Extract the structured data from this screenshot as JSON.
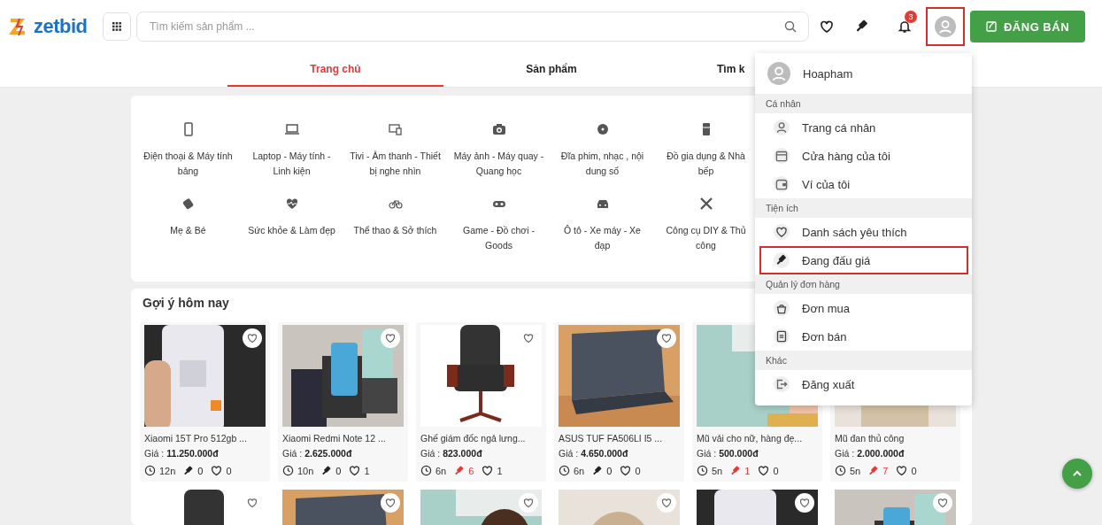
{
  "header": {
    "logo": "zetbid",
    "search": {
      "placeholder": "Tìm kiếm sản phẩm ..."
    },
    "notifications": {
      "count": "3"
    },
    "account": {
      "highlighted": true
    },
    "sell_button": "ĐĂNG BÁN"
  },
  "tabs": [
    {
      "label": "Trang chủ",
      "selected": true
    },
    {
      "label": "Sản phẩm",
      "selected": false
    },
    {
      "label": "Tìm k",
      "selected": false
    }
  ],
  "categories": [
    {
      "label": "Điện thoại & Máy tính bảng"
    },
    {
      "label": "Laptop - Máy tính - Linh kiện"
    },
    {
      "label": "Tivi - Âm thanh - Thiết bị nghe nhìn"
    },
    {
      "label": "Máy ảnh - Máy quay - Quang học"
    },
    {
      "label": "Đĩa phim, nhạc , nội dung số"
    },
    {
      "label": "Đồ gia dụng & Nhà bếp"
    },
    {
      "label": "Mẹ & Bé"
    },
    {
      "label": "Sức khỏe & Làm đẹp"
    },
    {
      "label": "Thể thao & Sở thích"
    },
    {
      "label": "Game - Đồ chơi - Goods"
    },
    {
      "label": "Ô tô - Xe máy - Xe đạp"
    },
    {
      "label": "Công cụ DIY & Thủ công"
    }
  ],
  "suggestions": {
    "title": "Gợi ý hôm nay",
    "products": [
      {
        "name": "Xiaomi 15T Pro 512gb ...",
        "price_label": "Giá :",
        "price": "11.250.000đ",
        "time": "12n",
        "bids": "0",
        "bids_active": false,
        "likes": "0",
        "favorite_button": true
      },
      {
        "name": "Xiaomi Redmi Note 12 ...",
        "price_label": "Giá :",
        "price": "2.625.000đ",
        "time": "10n",
        "bids": "0",
        "bids_active": false,
        "likes": "1",
        "favorite_button": true
      },
      {
        "name": "Ghế giám đốc ngả lưng...",
        "price_label": "Giá :",
        "price": "823.000đ",
        "time": "6n",
        "bids": "6",
        "bids_active": true,
        "likes": "1",
        "favorite_button": true
      },
      {
        "name": "ASUS TUF FA506LI I5 ...",
        "price_label": "Giá :",
        "price": "4.650.000đ",
        "time": "6n",
        "bids": "0",
        "bids_active": false,
        "likes": "0",
        "favorite_button": true
      },
      {
        "name": "Mũ vải cho nữ, hàng đẹ...",
        "price_label": "Giá :",
        "price": "500.000đ",
        "time": "5n",
        "bids": "1",
        "bids_active": true,
        "likes": "0"
      },
      {
        "name": "Mũ đan thủ công",
        "price_label": "Giá :",
        "price": "2.000.000đ",
        "time": "5n",
        "bids": "7",
        "bids_active": true,
        "likes": "0"
      }
    ]
  },
  "user_menu": {
    "user": "Hoapham",
    "sections": [
      {
        "title": "Cá nhân",
        "items": [
          {
            "label": "Trang cá nhân",
            "highlighted": false
          },
          {
            "label": "Cửa hàng của tôi",
            "highlighted": false
          },
          {
            "label": "Ví của tôi",
            "highlighted": false
          }
        ]
      },
      {
        "title": "Tiện ích",
        "items": [
          {
            "label": "Danh sách yêu thích",
            "highlighted": false
          },
          {
            "label": "Đang đấu giá",
            "highlighted": true
          }
        ]
      },
      {
        "title": "Quản lý đơn hàng",
        "items": [
          {
            "label": "Đơn mua",
            "highlighted": false
          },
          {
            "label": "Đơn bán",
            "highlighted": false
          }
        ]
      },
      {
        "title": "Khác",
        "items": [
          {
            "label": "Đăng xuất",
            "highlighted": false
          }
        ]
      }
    ]
  }
}
